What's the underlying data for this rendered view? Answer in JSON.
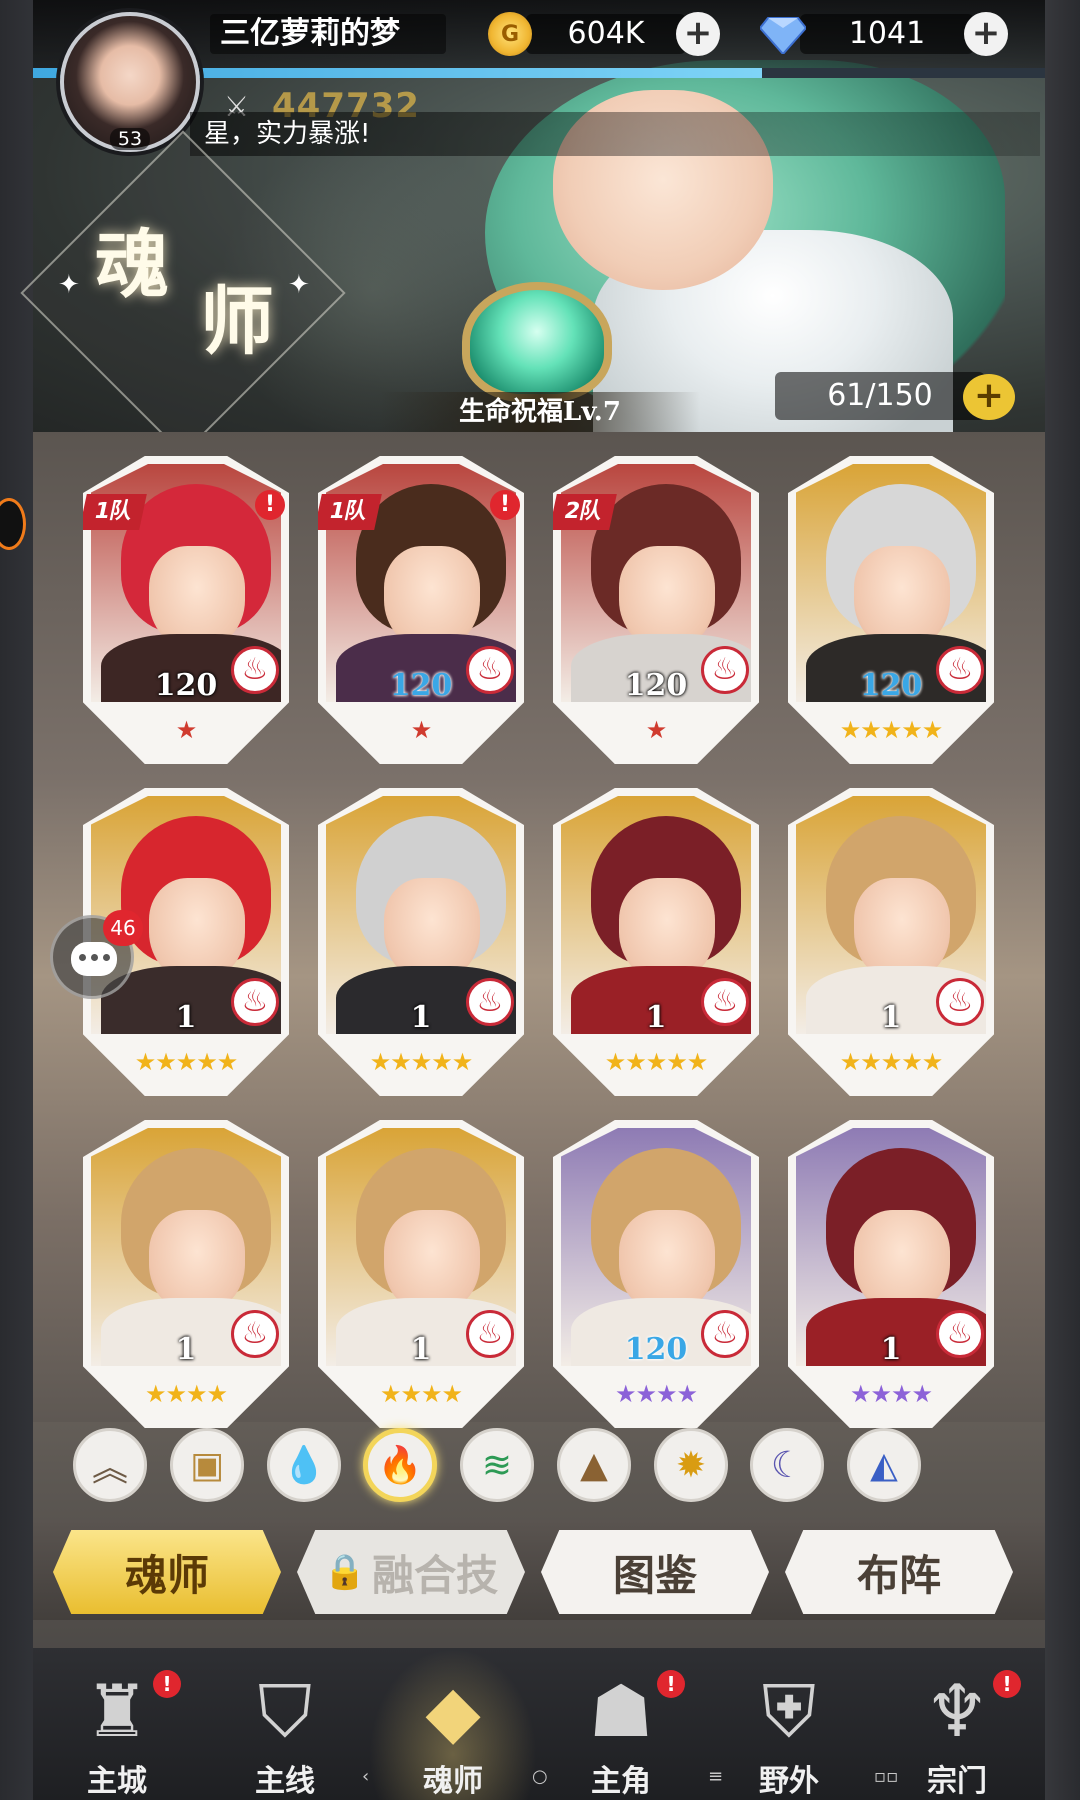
{
  "player": {
    "name": "三亿萝莉的梦",
    "level": "53",
    "power": "447732",
    "ticker": "星，实力暴涨!",
    "coins": "604K",
    "gems": "1041"
  },
  "page": {
    "title_char_1": "魂",
    "title_char_2": "师",
    "blessing": "生命祝福Lv.7",
    "capacity": "61/150",
    "hp_fraction": 0.72
  },
  "heroes": [
    {
      "level": "120",
      "stars": "★",
      "star_color": "red",
      "team": "1队",
      "alert": "!",
      "bg": "#b9463f",
      "hair": "#d4283a",
      "body": "#3d2624",
      "level_blue": false
    },
    {
      "level": "120",
      "stars": "★",
      "star_color": "red",
      "team": "1队",
      "alert": "!",
      "bg": "#b9463f",
      "hair": "#4a2c1d",
      "body": "#4b2d4a",
      "level_blue": true
    },
    {
      "level": "120",
      "stars": "★",
      "star_color": "red",
      "team": "2队",
      "alert": "",
      "bg": "#b9463f",
      "hair": "#6b2a26",
      "body": "#d7d3cf",
      "level_blue": false
    },
    {
      "level": "120",
      "stars": "★★★★★",
      "star_color": "gold",
      "team": "",
      "alert": "",
      "bg": "#d9a437",
      "hair": "#d7d7d7",
      "body": "#2d2a28",
      "level_blue": true
    },
    {
      "level": "1",
      "stars": "★★★★★",
      "star_color": "gold",
      "team": "",
      "alert": "",
      "bg": "#d9a437",
      "hair": "#d7262e",
      "body": "#3a2c2b",
      "level_blue": false
    },
    {
      "level": "1",
      "stars": "★★★★★",
      "star_color": "gold",
      "team": "",
      "alert": "",
      "bg": "#d9a437",
      "hair": "#d0d0d0",
      "body": "#2b2a2d",
      "level_blue": false
    },
    {
      "level": "1",
      "stars": "★★★★★",
      "star_color": "gold",
      "team": "",
      "alert": "",
      "bg": "#d9a437",
      "hair": "#7b1f27",
      "body": "#9a2026",
      "level_blue": false
    },
    {
      "level": "1",
      "stars": "★★★★★",
      "star_color": "gold",
      "team": "",
      "alert": "",
      "bg": "#d9a437",
      "hair": "#d1a56b",
      "body": "#efe9e2",
      "level_blue": false
    },
    {
      "level": "1",
      "stars": "★★★★",
      "star_color": "gold",
      "team": "",
      "alert": "",
      "bg": "#d9a437",
      "hair": "#d1a56b",
      "body": "#efe9e2",
      "level_blue": false
    },
    {
      "level": "1",
      "stars": "★★★★",
      "star_color": "gold",
      "team": "",
      "alert": "",
      "bg": "#d9a437",
      "hair": "#d1a56b",
      "body": "#efe9e2",
      "level_blue": false
    },
    {
      "level": "120",
      "stars": "★★★★",
      "star_color": "purple",
      "team": "",
      "alert": "",
      "bg": "#8e7bb4",
      "hair": "#d1a56b",
      "body": "#efe9e2",
      "level_blue": true
    },
    {
      "level": "1",
      "stars": "★★★★",
      "star_color": "purple",
      "team": "",
      "alert": "",
      "bg": "#8e7bb4",
      "hair": "#7b1f27",
      "body": "#9a2026",
      "level_blue": false
    }
  ],
  "chat": {
    "badge": "46"
  },
  "filters": [
    {
      "name": "rank-filter",
      "glyph": "︽",
      "color": "#6d5a45"
    },
    {
      "name": "box-filter",
      "glyph": "▣",
      "color": "#b78a3c"
    },
    {
      "name": "water-filter",
      "glyph": "💧",
      "color": "#2d7fd0"
    },
    {
      "name": "fire-filter",
      "glyph": "🔥",
      "color": "#d02a38"
    },
    {
      "name": "wind-filter",
      "glyph": "≋",
      "color": "#2d9a55"
    },
    {
      "name": "earth-filter",
      "glyph": "▲",
      "color": "#8a6233"
    },
    {
      "name": "light-filter",
      "glyph": "✹",
      "color": "#d99c12"
    },
    {
      "name": "dark-filter",
      "glyph": "☾",
      "color": "#5a55b0"
    },
    {
      "name": "arcane-filter",
      "glyph": "◭",
      "color": "#3a5fc5"
    }
  ],
  "tabs": [
    {
      "label": "魂师",
      "state": "active"
    },
    {
      "label": "融合技",
      "state": "locked"
    },
    {
      "label": "图鉴",
      "state": "normal"
    },
    {
      "label": "布阵",
      "state": "normal"
    }
  ],
  "nav": [
    {
      "label": "主城",
      "glyph": "♜",
      "dot": "!"
    },
    {
      "label": "主线",
      "glyph": "⛉",
      "dot": ""
    },
    {
      "label": "魂师",
      "glyph": "◆",
      "dot": ""
    },
    {
      "label": "主角",
      "glyph": "☗",
      "dot": "!"
    },
    {
      "label": "野外",
      "glyph": "⛨",
      "dot": ""
    },
    {
      "label": "宗门",
      "glyph": "♆",
      "dot": "!"
    }
  ],
  "active_nav": 2
}
